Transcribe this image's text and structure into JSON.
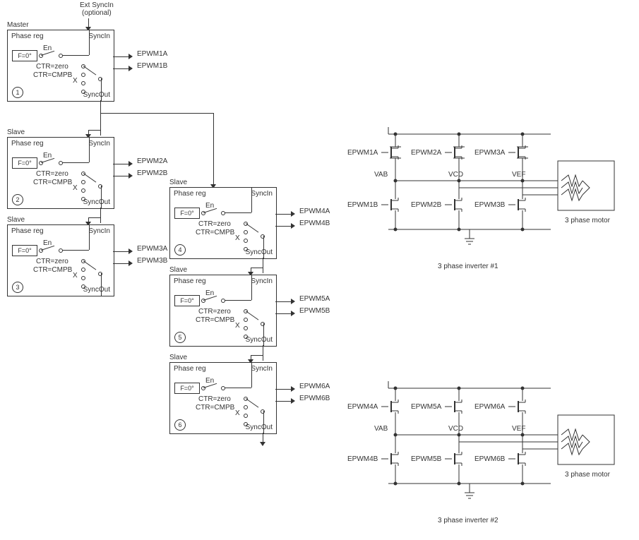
{
  "header": {
    "ext_sync_1": "Ext SyncIn",
    "ext_sync_2": "(optional)"
  },
  "module_common": {
    "phase_reg": "Phase reg",
    "sync_in": "SyncIn",
    "sync_out": "SyncOut",
    "en": "En",
    "phase_value": "F=0°",
    "ctr_zero": "CTR=zero",
    "ctr_cmpb": "CTR=CMPB",
    "x": "X"
  },
  "modules": [
    {
      "role": "Master",
      "num": "1",
      "outA": "EPWM1A",
      "outB": "EPWM1B"
    },
    {
      "role": "Slave",
      "num": "2",
      "outA": "EPWM2A",
      "outB": "EPWM2B"
    },
    {
      "role": "Slave",
      "num": "3",
      "outA": "EPWM3A",
      "outB": "EPWM3B"
    },
    {
      "role": "Slave",
      "num": "4",
      "outA": "EPWM4A",
      "outB": "EPWM4B"
    },
    {
      "role": "Slave",
      "num": "5",
      "outA": "EPWM5A",
      "outB": "EPWM5B"
    },
    {
      "role": "Slave",
      "num": "6",
      "outA": "EPWM6A",
      "outB": "EPWM6B"
    }
  ],
  "inverter1": {
    "topA": "EPWM1A",
    "topB": "EPWM2A",
    "topC": "EPWM3A",
    "botA": "EPWM1B",
    "botB": "EPWM2B",
    "botC": "EPWM3B",
    "phA": "VAB",
    "phB": "VCD",
    "phC": "VEF",
    "motor": "3 phase motor",
    "caption": "3 phase inverter #1"
  },
  "inverter2": {
    "topA": "EPWM4A",
    "topB": "EPWM5A",
    "topC": "EPWM6A",
    "botA": "EPWM4B",
    "botB": "EPWM5B",
    "botC": "EPWM6B",
    "phA": "VAB",
    "phB": "VCD",
    "phC": "VEF",
    "motor": "3 phase motor",
    "caption": "3 phase inverter #2"
  }
}
